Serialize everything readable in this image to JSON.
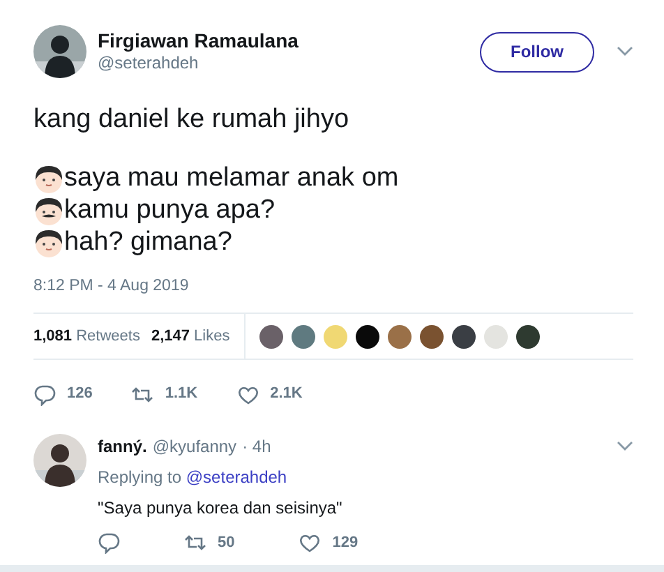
{
  "tweet": {
    "author": {
      "name": "Firgiawan Ramaulana",
      "handle": "@seterahdeh"
    },
    "follow_label": "Follow",
    "headline": "kang daniel ke rumah jihyo",
    "lines": [
      {
        "kind": "boy",
        "text": "saya mau melamar anak om"
      },
      {
        "kind": "man",
        "text": "kamu punya apa?"
      },
      {
        "kind": "boy",
        "text": "hah? gimana?"
      }
    ],
    "timestamp": "8:12 PM - 4 Aug 2019",
    "stats": [
      {
        "count": "1,081",
        "label": "Retweets"
      },
      {
        "count": "2,147",
        "label": "Likes"
      }
    ],
    "liker_avatars": [
      {
        "color": "#6a6168"
      },
      {
        "color": "#5f7a80"
      },
      {
        "color": "#f0d873"
      },
      {
        "color": "#0a0a0a"
      },
      {
        "color": "#9a7048"
      },
      {
        "color": "#7a5230"
      },
      {
        "color": "#3a3e44"
      },
      {
        "color": "#e4e4e0"
      },
      {
        "color": "#2e3a30"
      }
    ],
    "actions": [
      {
        "kind": "reply",
        "count": "126"
      },
      {
        "kind": "retweet",
        "count": "1.1K"
      },
      {
        "kind": "like",
        "count": "2.1K"
      }
    ]
  },
  "reply": {
    "name": "fanný.",
    "handle": "@kyufanny",
    "time": "· 4h",
    "replying_label": "Replying to",
    "replying_to": "@seterahdeh",
    "text": "\"Saya punya korea dan seisinya\"",
    "actions": [
      {
        "kind": "reply"
      },
      {
        "kind": "retweet",
        "count": "50"
      },
      {
        "kind": "like",
        "count": "129"
      }
    ]
  }
}
